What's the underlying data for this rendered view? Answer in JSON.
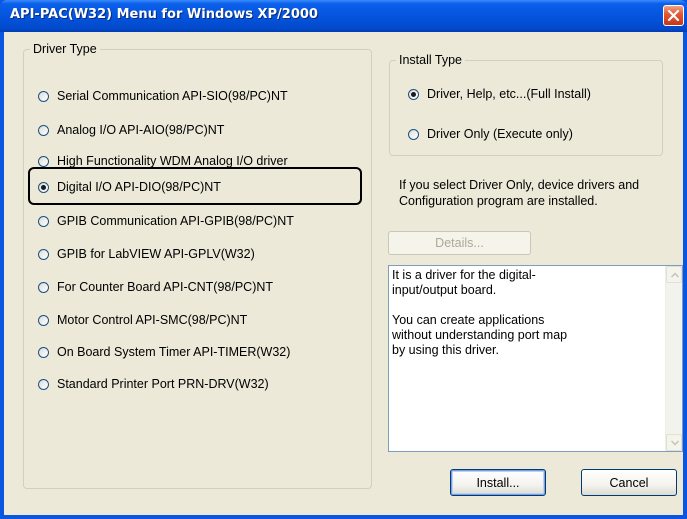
{
  "window": {
    "title": "API-PAC(W32) Menu for Windows XP/2000"
  },
  "driver_type": {
    "legend": "Driver Type",
    "selected_index": 3,
    "options": [
      "Serial Communication API-SIO(98/PC)NT",
      "Analog I/O API-AIO(98/PC)NT",
      "High Functionality WDM Analog I/O driver",
      "Digital I/O API-DIO(98/PC)NT",
      "GPIB Communication API-GPIB(98/PC)NT",
      "GPIB for LabVIEW API-GPLV(W32)",
      "For Counter Board API-CNT(98/PC)NT",
      "Motor Control API-SMC(98/PC)NT",
      "On Board System Timer API-TIMER(W32)",
      "Standard Printer Port PRN-DRV(W32)"
    ]
  },
  "install_type": {
    "legend": "Install Type",
    "selected_index": 0,
    "options": [
      "Driver, Help, etc...(Full Install)",
      "Driver Only (Execute only)"
    ]
  },
  "info": {
    "line1": "If you select Driver Only, device drivers and",
    "line2": "Configuration program are installed."
  },
  "buttons": {
    "details": "Details...",
    "install": "Install...",
    "cancel": "Cancel"
  },
  "description": {
    "text": "It is a driver for the digital-\ninput/output board.\n\nYou can create applications\nwithout understanding port map\nby using this driver."
  },
  "colors": {
    "title_bar": "#0453dd",
    "dialog_background": "#ece9d8",
    "close_button": "#e35a33",
    "radio_checked_dot": "#21a121"
  }
}
